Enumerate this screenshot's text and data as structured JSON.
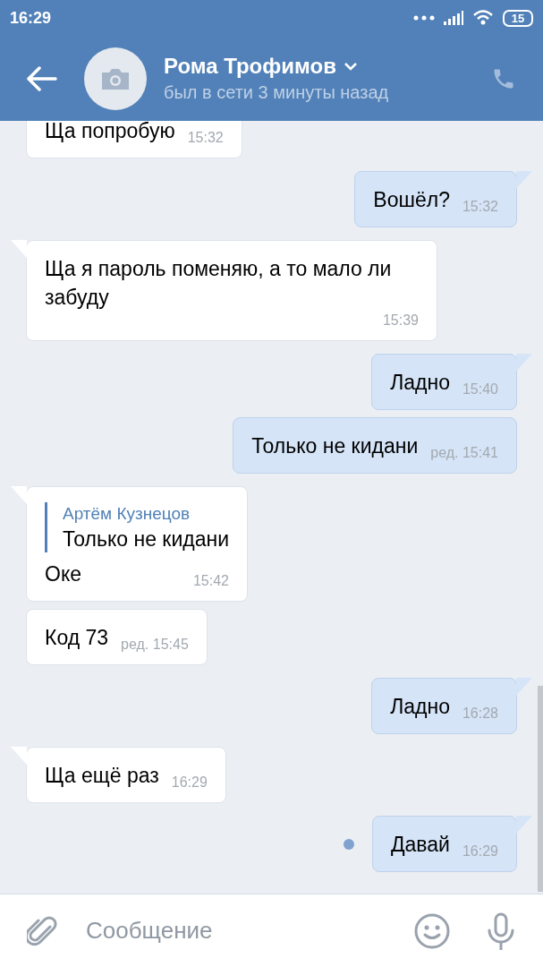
{
  "status_bar": {
    "time": "16:29",
    "battery": "15"
  },
  "header": {
    "name": "Рома Трофимов",
    "status": "был в сети 3 минуты назад"
  },
  "messages": [
    {
      "kind": "in",
      "text": "Ща попробую",
      "time": "15:32",
      "tail": false,
      "unread": false
    },
    {
      "kind": "out",
      "text": "Вошёл?",
      "time": "15:32",
      "tail": true,
      "unread": false
    },
    {
      "kind": "in",
      "text": "Ща я пароль поменяю, а то мало ли забуду",
      "time": "15:39",
      "tail": true,
      "unread": false
    },
    {
      "kind": "out",
      "text": "Ладно",
      "time": "15:40",
      "tail": true,
      "unread": false
    },
    {
      "kind": "out",
      "text": "Только не кидани",
      "time": "ред. 15:41",
      "tail": false,
      "unread": false
    },
    {
      "kind": "in",
      "quote": {
        "author": "Артём Кузнецов",
        "text": "Только не кидани"
      },
      "text": "Оке",
      "time": "15:42",
      "tail": true,
      "unread": false
    },
    {
      "kind": "in",
      "text": "Код 73",
      "time": "ред. 15:45",
      "tail": false,
      "unread": false
    },
    {
      "kind": "out",
      "text": "Ладно",
      "time": "16:28",
      "tail": true,
      "unread": false
    },
    {
      "kind": "in",
      "text": "Ща ещё раз",
      "time": "16:29",
      "tail": true,
      "unread": false
    },
    {
      "kind": "out",
      "text": "Давай",
      "time": "16:29",
      "tail": true,
      "unread": true
    }
  ],
  "composer": {
    "placeholder": "Сообщение"
  }
}
